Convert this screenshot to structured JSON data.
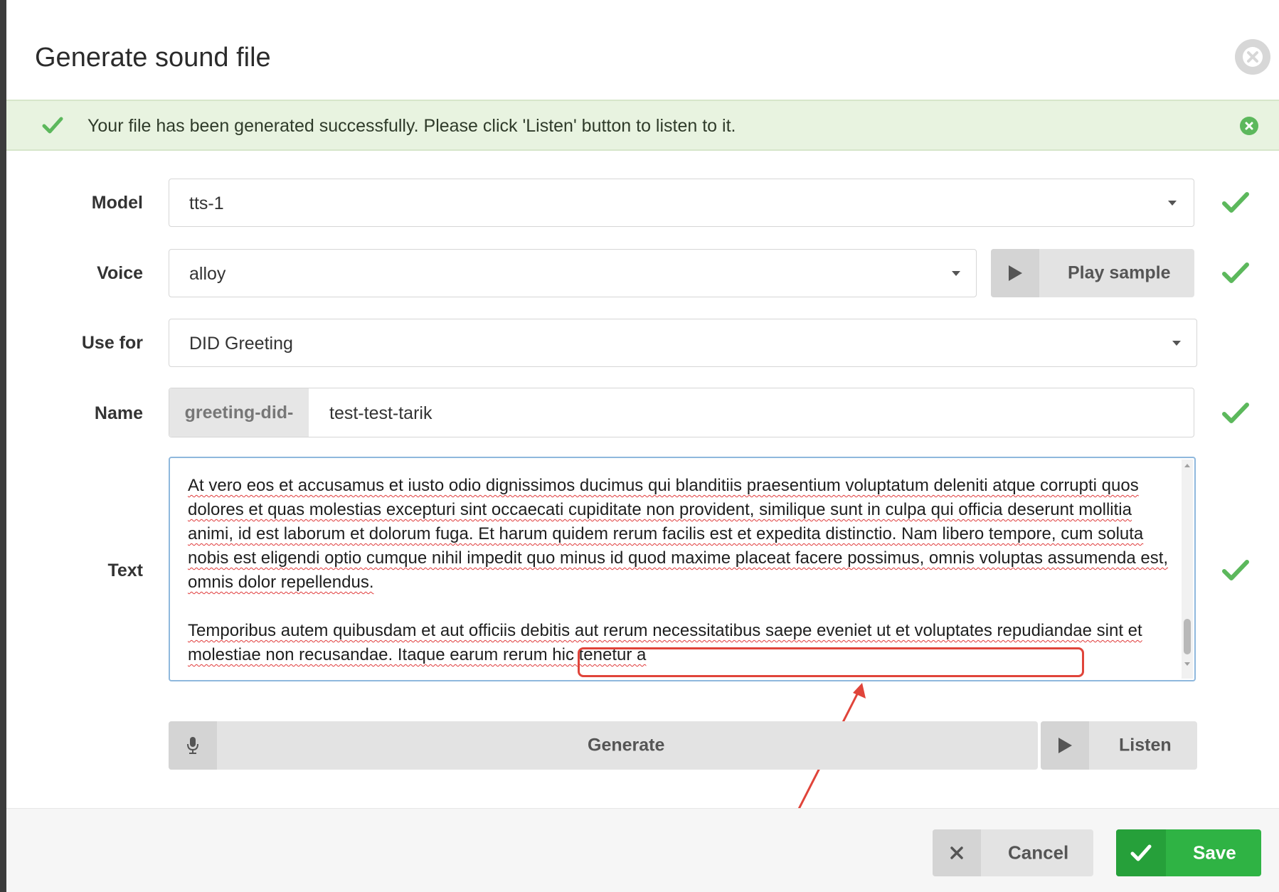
{
  "dialog": {
    "title": "Generate sound file"
  },
  "alert": {
    "message": "Your file has been generated successfully. Please click 'Listen' button to listen to it."
  },
  "form": {
    "model": {
      "label": "Model",
      "value": "tts-1"
    },
    "voice": {
      "label": "Voice",
      "value": "alloy",
      "play_sample_label": "Play sample"
    },
    "use_for": {
      "label": "Use for",
      "value": "DID Greeting"
    },
    "name": {
      "label": "Name",
      "prefix": "greeting-did-",
      "value": "test-test-tarik"
    },
    "text": {
      "label": "Text",
      "paragraph_1": "At vero eos et accusamus et iusto odio dignissimos ducimus qui blanditiis praesentium voluptatum deleniti atque corrupti quos dolores et quas molestias excepturi sint occaecati cupiditate non provident, similique sunt in culpa qui officia deserunt mollitia animi, id est laborum et dolorum fuga. Et harum quidem rerum facilis est et expedita distinctio. Nam libero tempore, cum soluta nobis est eligendi optio cumque nihil impedit quo minus id quod maxime placeat facere possimus, omnis voluptas assumenda est, omnis dolor repellendus.",
      "paragraph_2": "Temporibus autem quibusdam et aut officiis debitis aut rerum necessitatibus saepe eveniet ut et voluptates repudiandae sint et molestiae non recusandae. Itaque earum rerum hic tenetur a"
    }
  },
  "actions": {
    "generate_label": "Generate",
    "listen_label": "Listen",
    "cancel_label": "Cancel",
    "save_label": "Save"
  },
  "colors": {
    "success_green": "#5cb85c",
    "save_green": "#2fb344",
    "annotation_red": "#e0443a",
    "focus_blue": "#8fb8dd"
  }
}
